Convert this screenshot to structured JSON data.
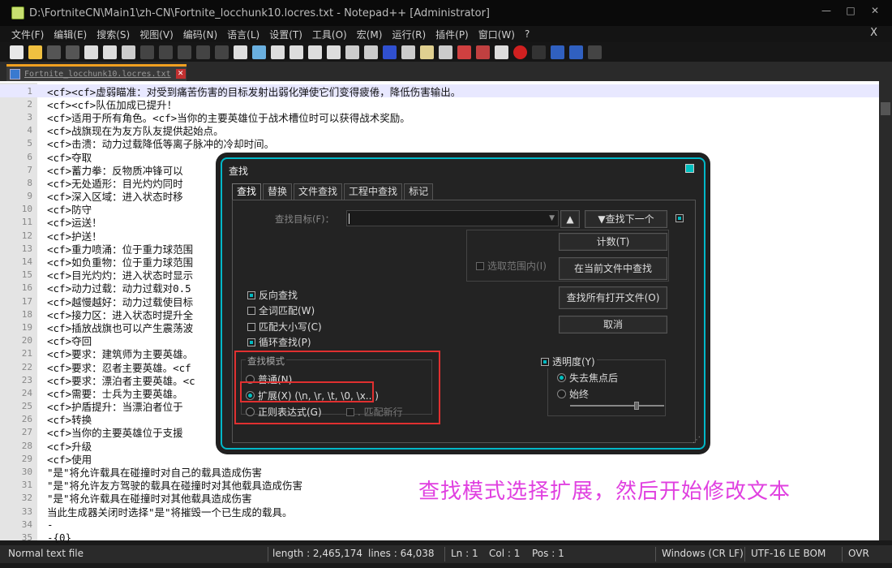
{
  "window": {
    "title": "D:\\FortniteCN\\Main1\\zh-CN\\Fortnite_locchunk10.locres.txt - Notepad++ [Administrator]"
  },
  "menu": [
    "文件(F)",
    "编辑(E)",
    "搜索(S)",
    "视图(V)",
    "编码(N)",
    "语言(L)",
    "设置(T)",
    "工具(O)",
    "宏(M)",
    "运行(R)",
    "插件(P)",
    "窗口(W)",
    "?"
  ],
  "menu_close": "X",
  "tab": {
    "name": "Fortnite_locchunk10.locres.txt"
  },
  "lines": [
    {
      "n": "1",
      "t": "<cf><cf>虚弱瞄准：对受到痛苦伤害的目标发射出弱化弹使它们变得疲倦，降低伤害输出。"
    },
    {
      "n": "2",
      "t": "<cf><cf>队伍加成已提升！"
    },
    {
      "n": "3",
      "t": "<cf>适用于所有角色。<cf>当你的主要英雄位于战术槽位时可以获得战术奖励。"
    },
    {
      "n": "4",
      "t": "<cf>战旗现在为友方队友提供起始点。"
    },
    {
      "n": "5",
      "t": "<cf>击溃：动力过载降低等离子脉冲的冷却时间。"
    },
    {
      "n": "6",
      "t": "<cf>夺取"
    },
    {
      "n": "7",
      "t": "<cf>蓄力拳：反物质冲锋可以"
    },
    {
      "n": "8",
      "t": "<cf>无处遁形：目光灼灼同时"
    },
    {
      "n": "9",
      "t": "<cf>深入区域：进入状态时移"
    },
    {
      "n": "10",
      "t": "<cf>防守"
    },
    {
      "n": "11",
      "t": "<cf>运送！"
    },
    {
      "n": "12",
      "t": "<cf>护送！"
    },
    {
      "n": "13",
      "t": "<cf>重力喷涌：位于重力球范围"
    },
    {
      "n": "14",
      "t": "<cf>如负重物：位于重力球范围"
    },
    {
      "n": "15",
      "t": "<cf>目光灼灼：进入状态时显示"
    },
    {
      "n": "16",
      "t": "<cf>动力过载：动力过载对0.5"
    },
    {
      "n": "17",
      "t": "<cf>越慢越好：动力过载使目标"
    },
    {
      "n": "18",
      "t": "<cf>接力区：进入状态时提升全"
    },
    {
      "n": "19",
      "t": "<cf>插放战旗也可以产生震荡波"
    },
    {
      "n": "20",
      "t": "<cf>夺回"
    },
    {
      "n": "21",
      "t": "<cf>要求：建筑师为主要英雄。"
    },
    {
      "n": "22",
      "t": "<cf>要求：忍者主要英雄。<cf"
    },
    {
      "n": "23",
      "t": "<cf>要求：漂泊者主要英雄。<c"
    },
    {
      "n": "24",
      "t": "<cf>需要：士兵为主要英雄。"
    },
    {
      "n": "25",
      "t": "<cf>护盾提升：当漂泊者位于"
    },
    {
      "n": "26",
      "t": "<cf>转换"
    },
    {
      "n": "27",
      "t": "<cf>当你的主要英雄位于支援"
    },
    {
      "n": "28",
      "t": "<cf>升级"
    },
    {
      "n": "29",
      "t": "<cf>使用"
    },
    {
      "n": "30",
      "t": " \"是\"将允许载具在碰撞时对自己的载具造成伤害"
    },
    {
      "n": "31",
      "t": "\"是\"将允许友方驾驶的载具在碰撞时对其他载具造成伤害"
    },
    {
      "n": "32",
      "t": "\"是\"将允许载具在碰撞时对其他载具造成伤害"
    },
    {
      "n": "33",
      "t": " 当此生成器关闭时选择\"是\"将摧毁一个已生成的载具。"
    },
    {
      "n": "34",
      "t": "-"
    },
    {
      "n": "35",
      "t": "-{0}"
    }
  ],
  "status": {
    "type": "Normal text file",
    "length": "length : 2,465,174",
    "lines": "lines : 64,038",
    "ln": "Ln : 1",
    "col": "Col : 1",
    "pos": "Pos : 1",
    "eol": "Windows (CR LF)",
    "enc": "UTF-16 LE BOM",
    "ovr": "OVR"
  },
  "dialog": {
    "title": "查找",
    "tabs": [
      "查找",
      "替换",
      "文件查找",
      "工程中查找",
      "标记"
    ],
    "find_label": "查找目标(F)：",
    "find_value": "",
    "up_arrow": "▲",
    "find_next": "▼查找下一个",
    "count": "计数(T)",
    "find_in_current": "在当前文件中查找",
    "find_all_open": "查找所有打开文件(O)",
    "cancel": "取消",
    "in_selection": "选取范围内(I)",
    "backward": "反向查找",
    "whole_word": "全词匹配(W)",
    "match_case": "匹配大小写(C)",
    "wrap": "循环查找(P)",
    "mode_title": "查找模式",
    "mode_normal": "普通(N)",
    "mode_extended": "扩展(X) (\\n, \\r, \\t, \\0, \\x...)",
    "mode_regex": "正则表达式(G)",
    "dot_newline": ". 匹配新行",
    "transparency": "透明度(Y)",
    "on_lose_focus": "失去焦点后",
    "always": "始终",
    "transparency_level": 0.72
  },
  "annotation": "查找模式选择扩展，然后开始修改文本"
}
